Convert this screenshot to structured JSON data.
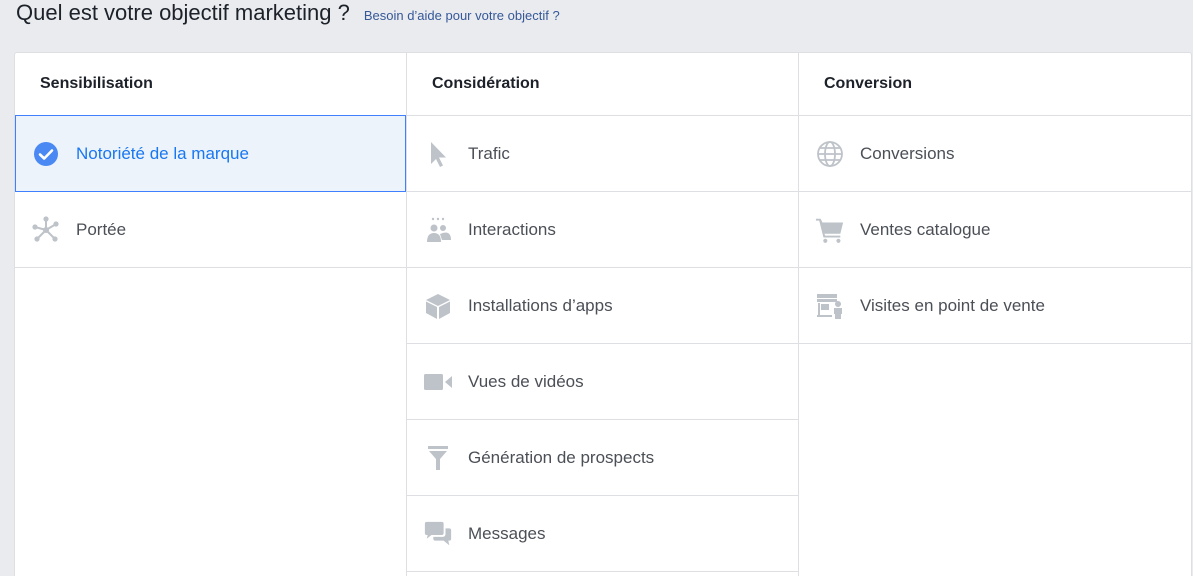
{
  "header": {
    "title": "Quel est votre objectif marketing ?",
    "help_link": "Besoin d’aide pour votre objectif ?"
  },
  "columns": [
    {
      "title": "Sensibilisation",
      "items": [
        {
          "label": "Notoriété de la marque",
          "icon": "check-circle-icon",
          "selected": true
        },
        {
          "label": "Portée",
          "icon": "reach-icon"
        }
      ]
    },
    {
      "title": "Considération",
      "items": [
        {
          "label": "Trafic",
          "icon": "cursor-icon"
        },
        {
          "label": "Interactions",
          "icon": "people-icon"
        },
        {
          "label": "Installations d’apps",
          "icon": "box-icon"
        },
        {
          "label": "Vues de vidéos",
          "icon": "video-camera-icon"
        },
        {
          "label": "Génération de prospects",
          "icon": "funnel-icon"
        },
        {
          "label": "Messages",
          "icon": "chat-bubbles-icon"
        }
      ]
    },
    {
      "title": "Conversion",
      "items": [
        {
          "label": "Conversions",
          "icon": "globe-icon"
        },
        {
          "label": "Ventes catalogue",
          "icon": "shopping-cart-icon"
        },
        {
          "label": "Visites en point de vente",
          "icon": "store-icon"
        }
      ]
    }
  ],
  "colors": {
    "accent": "#1877f2",
    "selected_bg": "#edf3fb",
    "icon_gray": "#bec3c9"
  }
}
